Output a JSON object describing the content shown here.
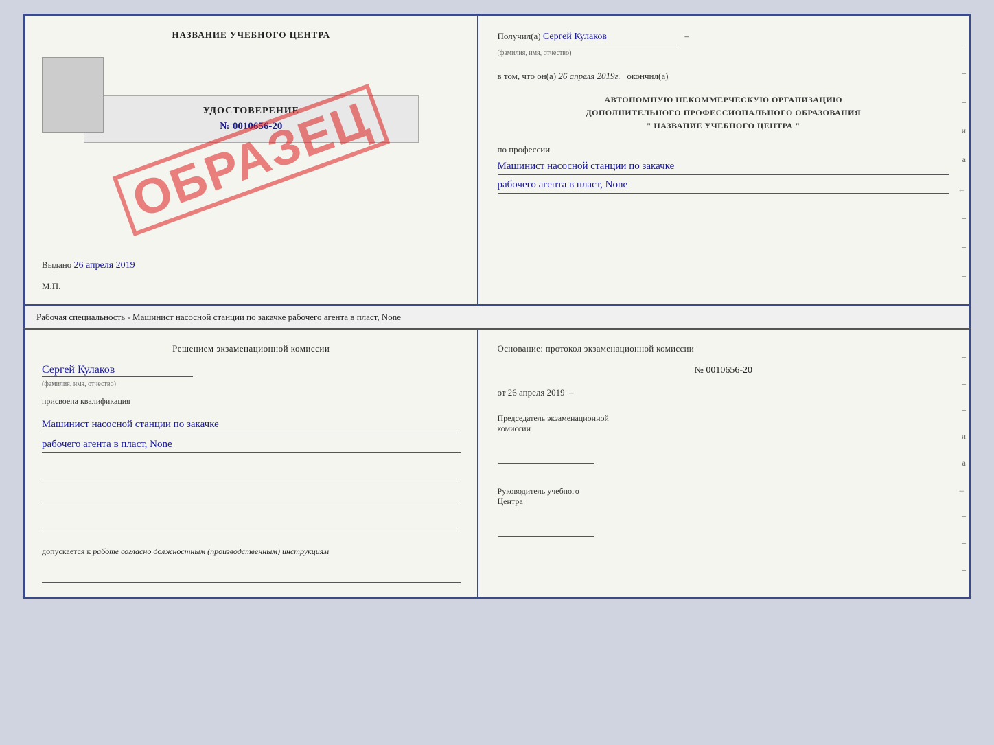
{
  "top": {
    "left": {
      "title": "НАЗВАНИЕ УЧЕБНОГО ЦЕНТРА",
      "stamp": "ОБРАЗЕЦ",
      "cert_type": "УДОСТОВЕРЕНИЕ",
      "cert_number": "№ 0010656-20",
      "vydano_label": "Выдано",
      "vydano_date": "26 апреля 2019",
      "mp": "М.П."
    },
    "right": {
      "poluchil_label": "Получил(а)",
      "poluchil_value": "Сергей Кулаков",
      "familiya_label": "(фамилия, имя, отчество)",
      "vtom_label": "в том, что он(а)",
      "vtom_date": "26 апреля 2019г.",
      "okonchil_label": "окончил(а)",
      "org_line1": "АВТОНОМНУЮ НЕКОММЕРЧЕСКУЮ ОРГАНИЗАЦИЮ",
      "org_line2": "ДОПОЛНИТЕЛЬНОГО ПРОФЕССИОНАЛЬНОГО ОБРАЗОВАНИЯ",
      "org_line3": "\"  НАЗВАНИЕ УЧЕБНОГО ЦЕНТРА  \"",
      "po_professii": "по профессии",
      "profession_line1": "Машинист насосной станции по закачке",
      "profession_line2": "рабочего агента в пласт, None",
      "side_dashes": [
        "-",
        "-",
        "-",
        "и",
        "а",
        "←",
        "-",
        "-",
        "-"
      ]
    }
  },
  "subtitle": "Рабочая специальность - Машинист насосной станции по закачке рабочего агента в пласт,\nNone",
  "bottom": {
    "left": {
      "resheniyem": "Решением экзаменационной комиссии",
      "name_hw": "Сергей Кулаков",
      "familiya_label": "(фамилия, имя, отчество)",
      "prisvoena": "присвоена квалификация",
      "profession_line1": "Машинист насосной станции по закачке",
      "profession_line2": "рабочего агента в пласт, None",
      "dopuskaetsya_label": "допускается к",
      "dopuskaetsya_value": "работе согласно должностным (производственным) инструкциям"
    },
    "right": {
      "osnovanie_label": "Основание: протокол экзаменационной комиссии",
      "number": "№ 0010656-20",
      "ot_label": "от",
      "ot_date": "26 апреля 2019",
      "predsedatel_line1": "Председатель экзаменационной",
      "predsedatel_line2": "комиссии",
      "rukovoditel_line1": "Руководитель учебного",
      "rukovoditel_line2": "Центра",
      "side_dashes": [
        "-",
        "-",
        "-",
        "и",
        "а",
        "←",
        "-",
        "-",
        "-"
      ]
    }
  }
}
